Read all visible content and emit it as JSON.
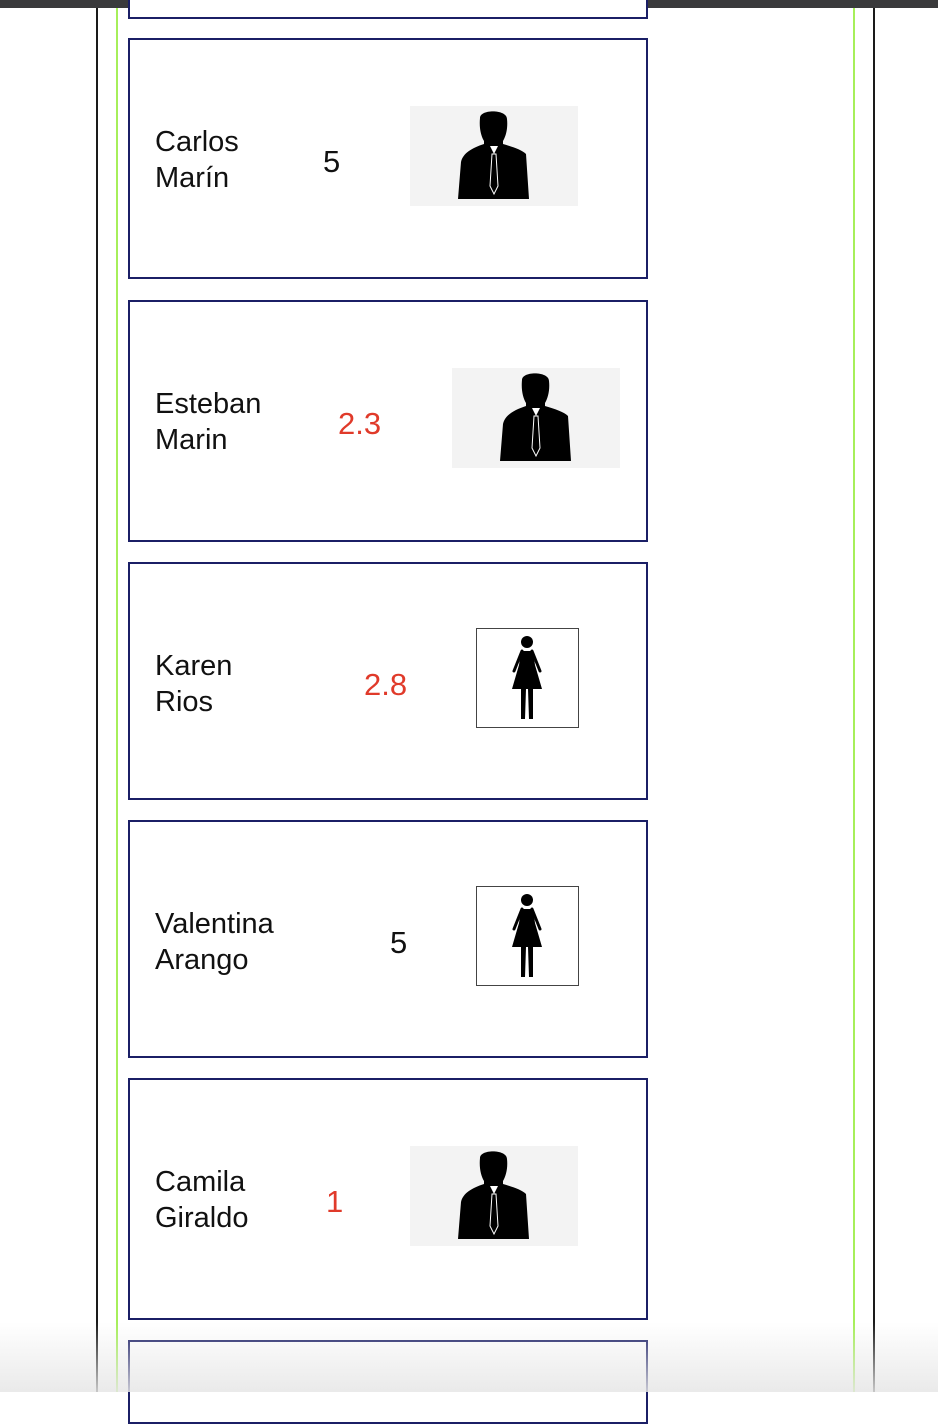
{
  "cards": [
    {
      "first": "Carlos",
      "last": "Marín",
      "score": "5",
      "score_color": "#111111",
      "avatar": "male-silhouette-icon"
    },
    {
      "first": "Esteban",
      "last": "Marin",
      "score": "2.3",
      "score_color": "#e03a2a",
      "avatar": "male-silhouette-icon"
    },
    {
      "first": "Karen",
      "last": "Rios",
      "score": "2.8",
      "score_color": "#e03a2a",
      "avatar": "female-figure-icon"
    },
    {
      "first": "Valentina",
      "last": "Arango",
      "score": "5",
      "score_color": "#111111",
      "avatar": "female-figure-icon"
    },
    {
      "first": "Camila",
      "last": "Giraldo",
      "score": "1",
      "score_color": "#e03a2a",
      "avatar": "male-silhouette-icon"
    }
  ],
  "colors": {
    "card_border": "#1b1f66",
    "accent_line": "#a6ef5a",
    "low_score": "#e03a2a"
  }
}
